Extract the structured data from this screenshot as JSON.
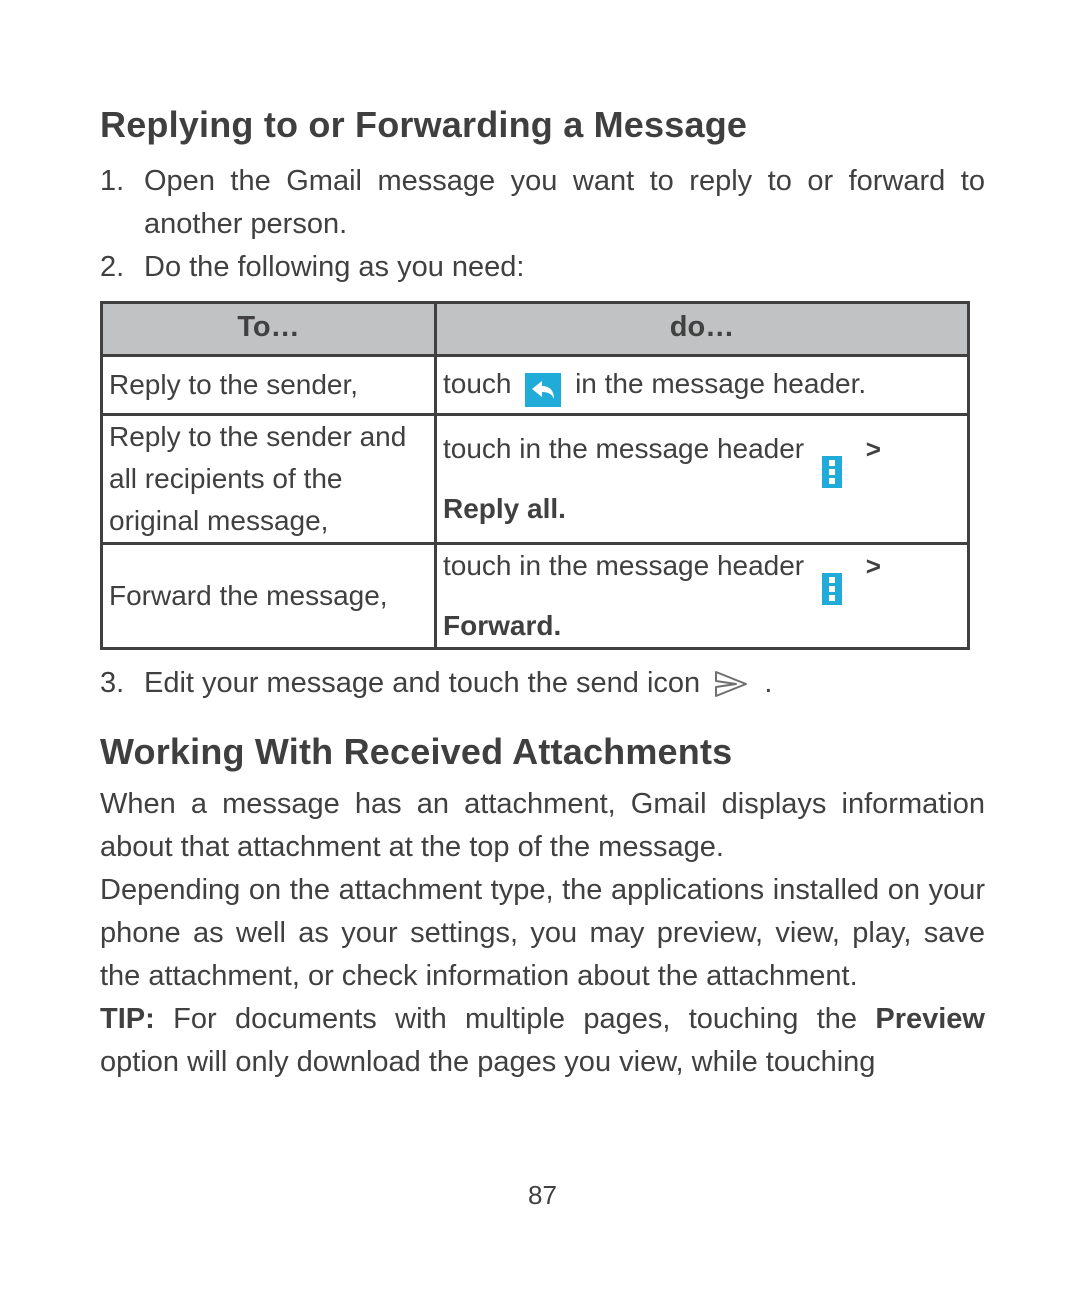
{
  "heading1": "Replying to or Forwarding a Message",
  "step1": {
    "num": "1.",
    "text": "Open the Gmail message you want to reply to or forward to another person."
  },
  "step2": {
    "num": "2.",
    "text": "Do the following as you need:"
  },
  "table": {
    "th1": "To…",
    "th2": "do…",
    "r1c1": "Reply to the sender,",
    "r1c2_a": "touch",
    "r1c2_b": "in the message header.",
    "r2c1": "Reply to the sender and all recipients of the original message,",
    "r2c2_a": "touch in the message header",
    "r2c2_b": "Reply all.",
    "r3c1": "Forward the message,",
    "r3c2_a": "touch in the message header",
    "r3c2_b": "Forward."
  },
  "step3": {
    "num": "3.",
    "text_a": "Edit your message and touch the send icon",
    "text_b": "."
  },
  "heading2": "Working With Received Attachments",
  "p1": "When a message has an attachment, Gmail displays information about that attachment at the top of the message.",
  "p2": "Depending on the attachment type, the applications installed on your phone as well as your settings, you may preview, view, play, save the attachment, or check information about the attachment.",
  "tip_label": "TIP:",
  "tip_text_a": " For documents with multiple pages, touching the ",
  "tip_bold": "Preview",
  "tip_text_b": " option will only download the pages you view, while touching",
  "page_number": "87"
}
